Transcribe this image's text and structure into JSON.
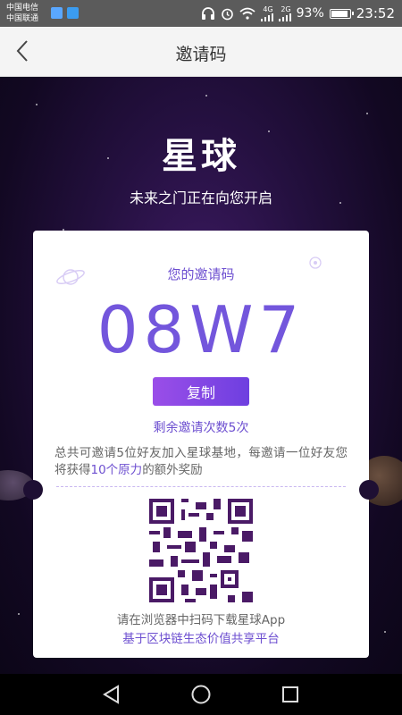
{
  "status_bar": {
    "carrier_1": "中国电信",
    "carrier_2": "中国联通",
    "signal_1": "4G",
    "signal_2": "2G",
    "battery": "93%",
    "time": "23:52"
  },
  "app_bar": {
    "title": "邀请码"
  },
  "hero": {
    "logo": "星球",
    "slogan": "未来之门正在向您开启"
  },
  "invite": {
    "label": "您的邀请码",
    "code": "08W7",
    "copy_label": "复制",
    "remaining": "剩余邀请次数5次",
    "desc_part1": "总共可邀请5位好友加入星球基地，每邀请一位好友您将获得",
    "desc_highlight": "10个原力",
    "desc_part2": "的额外奖励",
    "scan_tip": "请在浏览器中扫码下载星球App",
    "platform": "基于区块链生态价值共享平台"
  },
  "colors": {
    "accent": "#7356dc",
    "button_start": "#9a4ee8",
    "button_end": "#6e3fe0",
    "background": "#24103f"
  }
}
